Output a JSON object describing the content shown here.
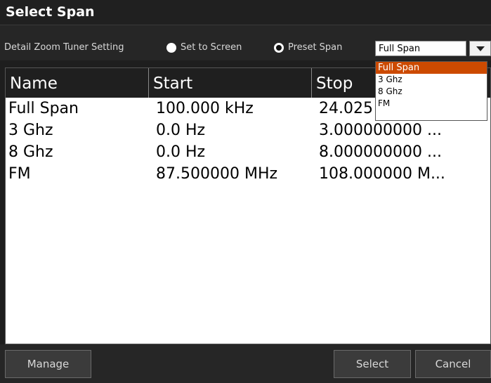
{
  "window": {
    "title": "Select Span"
  },
  "settings": {
    "label": "Detail Zoom Tuner Setting",
    "options": [
      {
        "label": "Set to Screen",
        "selected": false
      },
      {
        "label": "Preset Span",
        "selected": true
      }
    ]
  },
  "dropdown": {
    "value": "Full Span",
    "options": [
      "Full Span",
      "3 Ghz",
      "8 Ghz",
      "FM"
    ],
    "highlighted": "Full Span"
  },
  "table": {
    "columns": [
      "Name",
      "Start",
      "Stop"
    ],
    "rows": [
      [
        "Full Span",
        "100.000 kHz",
        "24.025"
      ],
      [
        "3 Ghz",
        "0.0 Hz",
        "3.000000000 ..."
      ],
      [
        "8 Ghz",
        "0.0 Hz",
        "8.000000000 ..."
      ],
      [
        "FM",
        "87.500000 MHz",
        "108.000000 M..."
      ]
    ]
  },
  "footer": {
    "manage_label": "Manage",
    "select_label": "Select",
    "cancel_label": "Cancel"
  },
  "colors": {
    "highlight": "#cc4a00",
    "background": "#1e1e1e"
  }
}
